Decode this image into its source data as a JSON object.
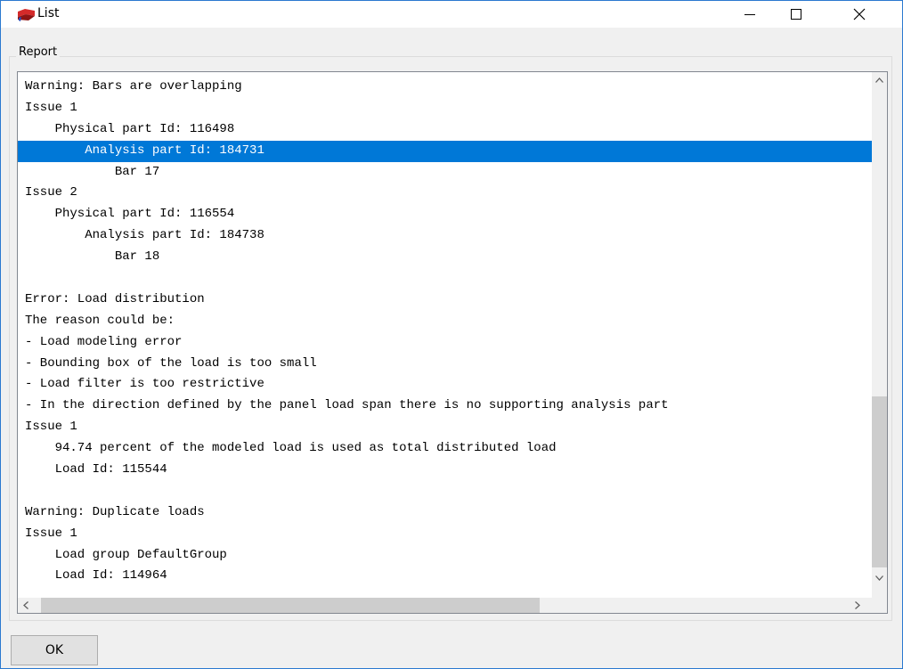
{
  "window": {
    "title": "List",
    "icon": "red-flag-app-icon",
    "controls": [
      "minimize-icon",
      "maximize-icon",
      "close-icon"
    ]
  },
  "report": {
    "label": "Report",
    "selected_line": 3,
    "lines": [
      "Warning: Bars are overlapping",
      "Issue 1",
      "    Physical part Id: 116498",
      "        Analysis part Id: 184731",
      "            Bar 17",
      "Issue 2",
      "    Physical part Id: 116554",
      "        Analysis part Id: 184738",
      "            Bar 18",
      "",
      "Error: Load distribution",
      "The reason could be:",
      "- Load modeling error",
      "- Bounding box of the load is too small",
      "- Load filter is too restrictive",
      "- In the direction defined by the panel load span there is no supporting analysis part",
      "Issue 1",
      "    94.74 percent of the modeled load is used as total distributed load",
      "    Load Id: 115544",
      "",
      "Warning: Duplicate loads",
      "Issue 1",
      "    Load group DefaultGroup",
      "    Load Id: 114964"
    ]
  },
  "buttons": {
    "ok_label": "OK"
  },
  "colors": {
    "selection": "#0078d7",
    "title_bar_border": "#2b79d0"
  }
}
